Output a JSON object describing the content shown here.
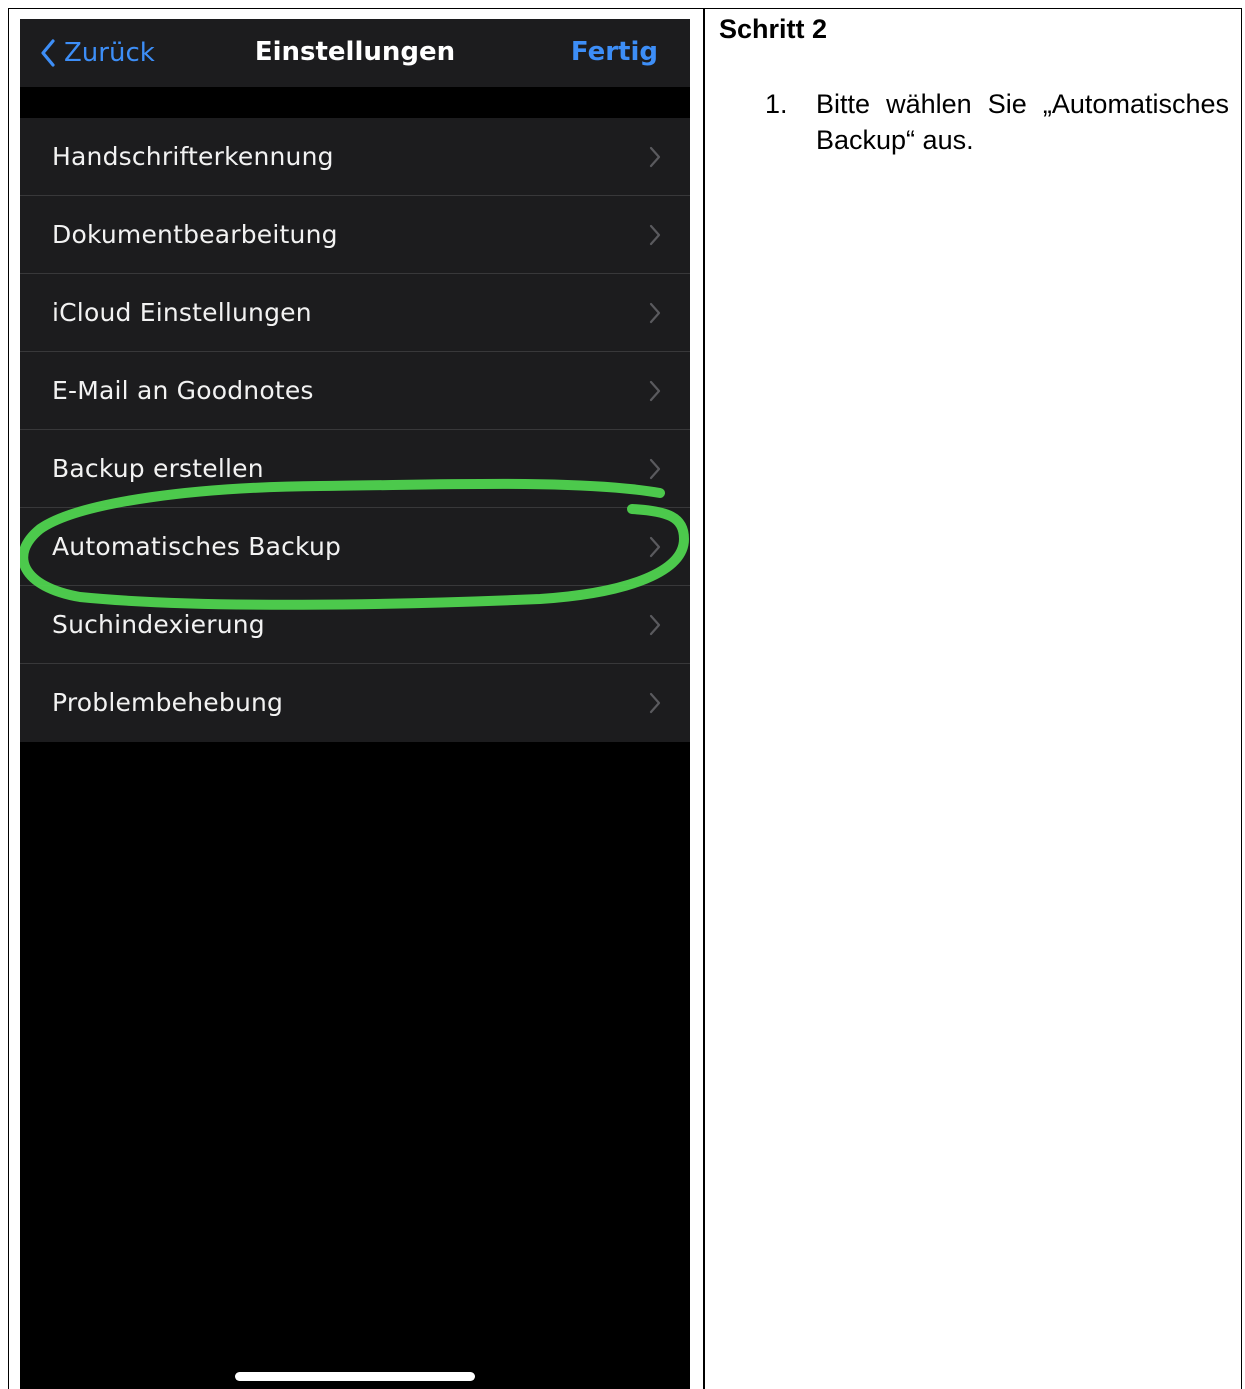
{
  "phone": {
    "nav": {
      "back_label": "Zurück",
      "title": "Einstellungen",
      "done_label": "Fertig"
    },
    "settings_items": [
      {
        "label": "Handschrifterkennung"
      },
      {
        "label": "Dokumentbearbeitung"
      },
      {
        "label": "iCloud Einstellungen"
      },
      {
        "label": "E-Mail an Goodnotes"
      },
      {
        "label": "Backup erstellen"
      },
      {
        "label": "Automatisches Backup",
        "highlighted": true
      },
      {
        "label": "Suchindexierung"
      },
      {
        "label": "Problembehebung"
      }
    ],
    "colors": {
      "accent": "#3d8ef7",
      "row_bg": "#1c1c1e",
      "highlight": "#4fd34f"
    },
    "icons": {
      "back": "chevron-left-icon",
      "row": "chevron-right-icon"
    }
  },
  "instructions": {
    "title": "Schritt 2",
    "steps": [
      {
        "number": "1.",
        "text": "Bitte wählen Sie „Automatisches Backup“ aus."
      }
    ]
  }
}
